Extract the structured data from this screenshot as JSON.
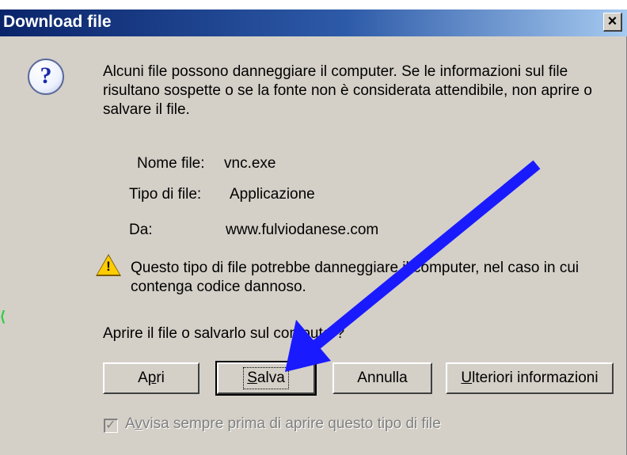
{
  "dialog": {
    "title": "Download file",
    "close_label": "×",
    "intro": "Alcuni file possono danneggiare il computer. Se le informazioni sul file risultano sospette o se la fonte non è considerata attendibile, non aprire o salvare il file.",
    "file_info": {
      "name_label": "Nome file:",
      "name_value": "vnc.exe",
      "type_label": "Tipo di file:",
      "type_value": "Applicazione",
      "from_label": "Da:",
      "from_value": "www.fulviodanese.com"
    },
    "warning": "Questo tipo di file potrebbe danneggiare il computer, nel caso in cui contenga codice dannoso.",
    "question": "Aprire il file o salvarlo sul computer?",
    "buttons": {
      "open_pre": "A",
      "open_u": "p",
      "open_post": "ri",
      "save_u": "S",
      "save_post": "alva",
      "cancel": "Annulla",
      "more_u": "U",
      "more_post": "lteriori informazioni"
    },
    "checkbox": {
      "checked": true,
      "label_pre": "A",
      "label_u": "v",
      "label_post": "visa sempre prima di aprire questo tipo di file"
    }
  },
  "colors": {
    "title_start": "#0a246a",
    "title_end": "#a6caf0",
    "face": "#d4d0c8",
    "annotation_arrow": "#1a1aff"
  },
  "icons": {
    "dialog_icon": "question-icon",
    "warning_icon": "warning-icon",
    "close_icon": "close-icon"
  }
}
